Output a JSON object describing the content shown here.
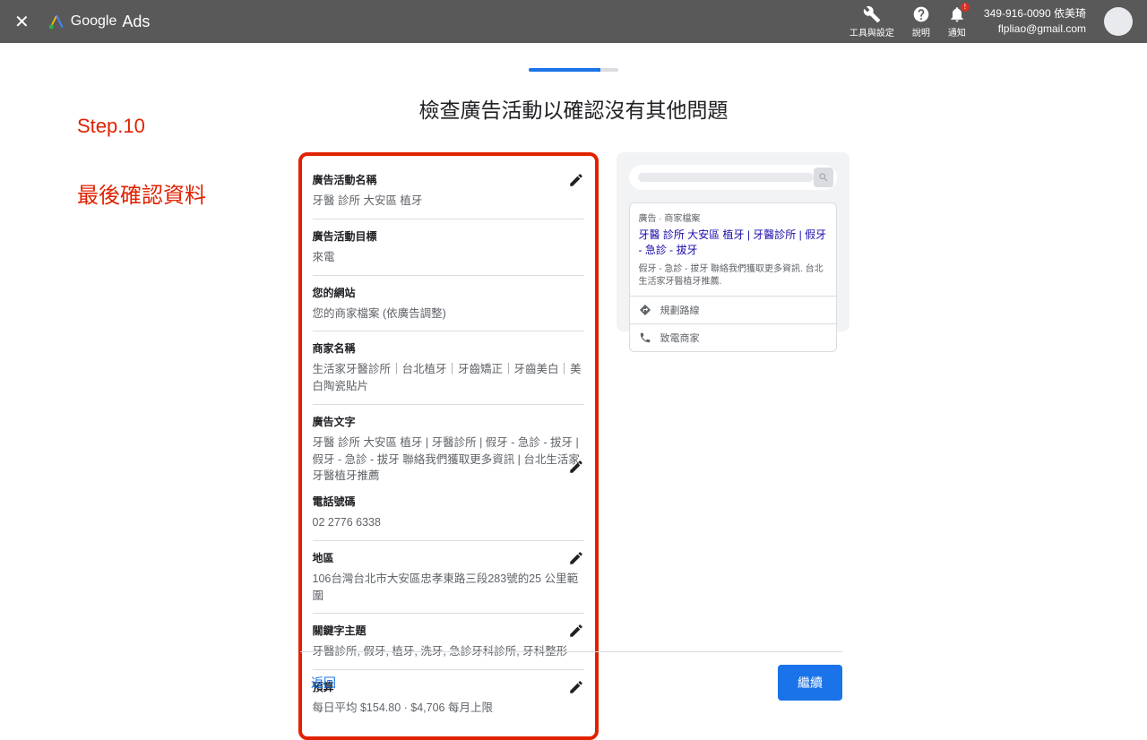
{
  "header": {
    "brand": "Google",
    "product": "Ads",
    "tools_label": "工具與設定",
    "help_label": "說明",
    "notif_label": "通知",
    "account_id": "349-916-0090 依美琦",
    "account_email": "flpliao@gmail.com"
  },
  "page_title": "檢查廣告活動以確認沒有其他問題",
  "annotation": {
    "step": "Step.10",
    "subtitle": "最後確認資料"
  },
  "summary": {
    "campaign_name": {
      "label": "廣告活動名稱",
      "value": "牙醫 診所 大安區 植牙"
    },
    "goal": {
      "label": "廣告活動目標",
      "value": "來電"
    },
    "website": {
      "label": "您的網站",
      "value": "您的商家檔案 (依廣告調整)"
    },
    "business": {
      "label": "商家名稱",
      "value": "生活家牙醫診所｜台北植牙｜牙齒矯正｜牙齒美白｜美白陶瓷貼片"
    },
    "adtext": {
      "label": "廣告文字",
      "value": "牙醫 診所 大安區 植牙 | 牙醫診所 | 假牙 - 急診 - 拔牙 | 假牙 - 急診 - 拔牙 聯絡我們獲取更多資訊 | 台北生活家牙醫植牙推薦"
    },
    "phone": {
      "label": "電話號碼",
      "value": "02 2776 6338"
    },
    "region": {
      "label": "地區",
      "value": "106台灣台北市大安區忠孝東路三段283號的25 公里範圍"
    },
    "keywords": {
      "label": "關鍵字主題",
      "value": "牙醫診所, 假牙, 植牙, 洗牙, 急診牙科診所, 牙科整形"
    },
    "budget": {
      "label": "預算",
      "value": "每日平均 $154.80 · $4,706 每月上限"
    }
  },
  "preview": {
    "ad_label": "廣告 · 商家檔案",
    "ad_title": "牙醫 診所 大安區 植牙 | 牙醫診所 | 假牙 - 急診 - 拔牙",
    "ad_desc": "假牙 - 急診 - 拔牙 聯絡我們獲取更多資訊. 台北生活家牙醫植牙推薦.",
    "directions": "規劃路線",
    "call": "致電商家"
  },
  "footer": {
    "back": "返回",
    "continue": "繼續"
  }
}
